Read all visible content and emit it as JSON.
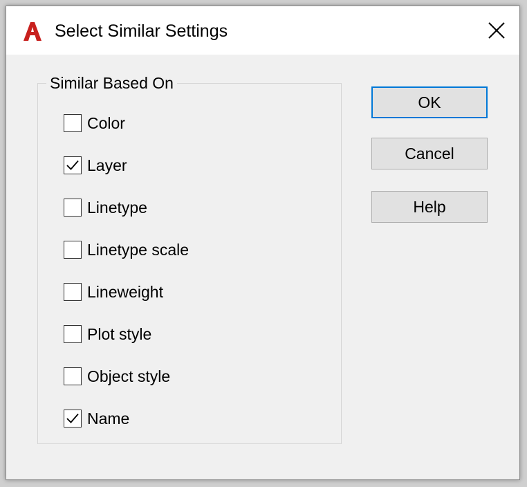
{
  "window": {
    "title": "Select Similar Settings",
    "app_icon": "autocad-a-logo-icon",
    "close_icon": "close-icon"
  },
  "group": {
    "legend": "Similar Based On",
    "options": [
      {
        "label": "Color",
        "checked": false
      },
      {
        "label": "Layer",
        "checked": true
      },
      {
        "label": "Linetype",
        "checked": false
      },
      {
        "label": "Linetype scale",
        "checked": false
      },
      {
        "label": "Lineweight",
        "checked": false
      },
      {
        "label": "Plot style",
        "checked": false
      },
      {
        "label": "Object style",
        "checked": false
      },
      {
        "label": "Name",
        "checked": true
      }
    ]
  },
  "buttons": {
    "ok": "OK",
    "cancel": "Cancel",
    "help": "Help"
  },
  "colors": {
    "app_icon_red": "#c8201e",
    "default_button_border": "#0078d7"
  }
}
